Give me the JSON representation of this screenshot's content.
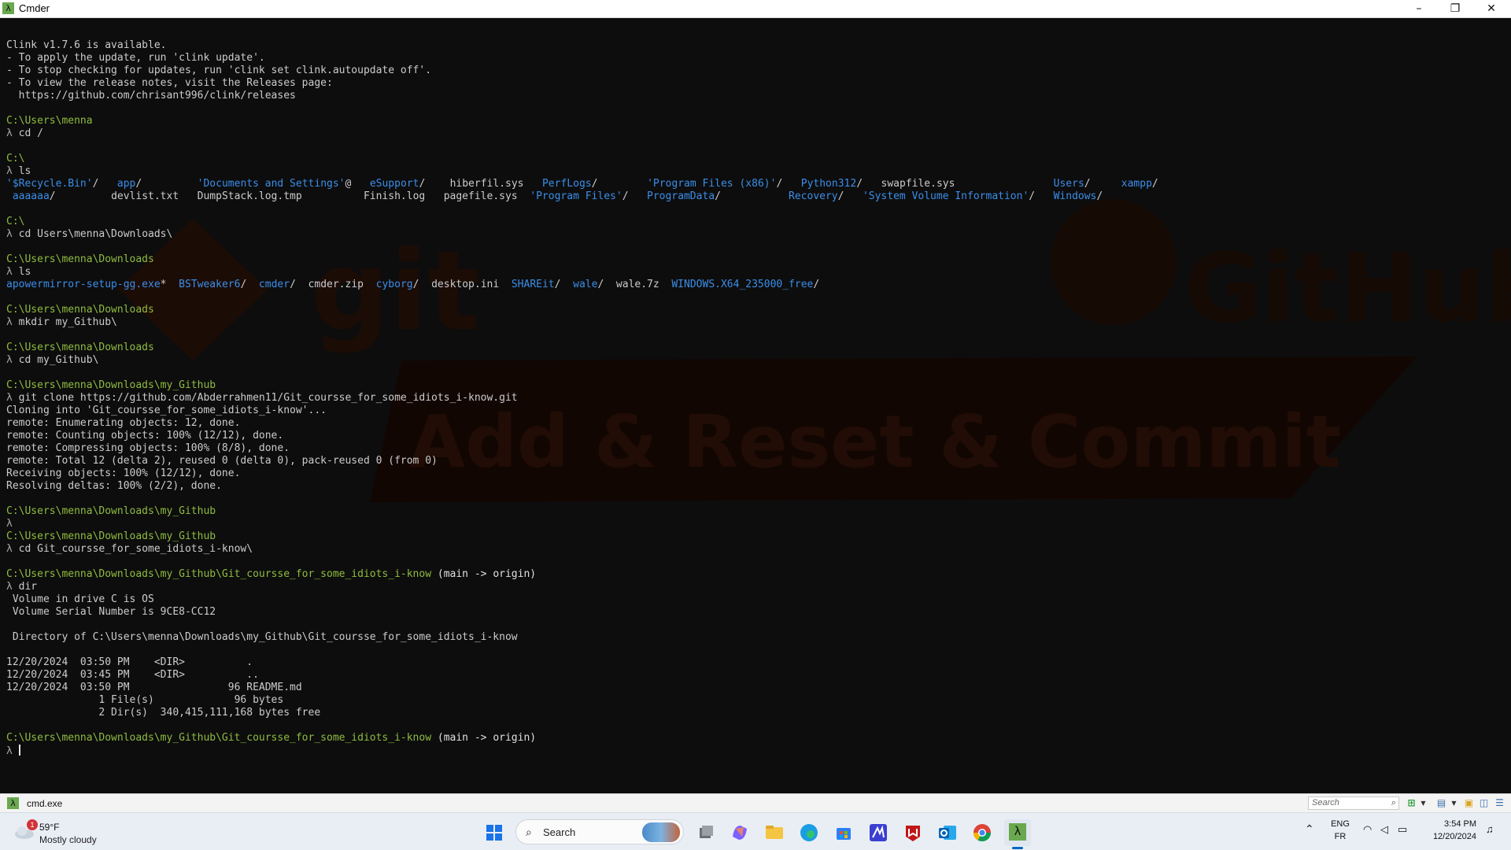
{
  "window": {
    "title": "Cmder",
    "app_icon": "lambda-icon",
    "controls": {
      "minimize": "–",
      "maximize": "❐",
      "close": "✕"
    }
  },
  "terminal": {
    "watermark_text": {
      "git": "git",
      "github": "GitHub",
      "subtitle": "Add & Reset & Commit"
    },
    "lines": [
      [
        {
          "t": "Clink v1.7.6 is available.",
          "c": ""
        }
      ],
      [
        {
          "t": "- To apply the update, run 'clink update'.",
          "c": ""
        }
      ],
      [
        {
          "t": "- To stop checking for updates, run 'clink set clink.autoupdate off'.",
          "c": ""
        }
      ],
      [
        {
          "t": "- To view the release notes, visit the Releases page:",
          "c": ""
        }
      ],
      [
        {
          "t": "  https://github.com/chrisant996/clink/releases",
          "c": ""
        }
      ],
      [],
      [
        {
          "t": "C:\\Users\\menna",
          "c": "prompt"
        }
      ],
      [
        {
          "t": "λ ",
          "c": "lam"
        },
        {
          "t": "cd /",
          "c": ""
        }
      ],
      [],
      [
        {
          "t": "C:\\",
          "c": "prompt"
        }
      ],
      [
        {
          "t": "λ ",
          "c": "lam"
        },
        {
          "t": "ls",
          "c": ""
        }
      ],
      [
        {
          "t": "'$Recycle.Bin'",
          "c": "dir"
        },
        {
          "t": "/   ",
          "c": ""
        },
        {
          "t": "app",
          "c": "dir"
        },
        {
          "t": "/         ",
          "c": ""
        },
        {
          "t": "'Documents and Settings'",
          "c": "dir"
        },
        {
          "t": "@   ",
          "c": ""
        },
        {
          "t": "eSupport",
          "c": "dir"
        },
        {
          "t": "/    hiberfil.sys   ",
          "c": ""
        },
        {
          "t": "PerfLogs",
          "c": "dir"
        },
        {
          "t": "/        ",
          "c": ""
        },
        {
          "t": "'Program Files (x86)'",
          "c": "dir"
        },
        {
          "t": "/   ",
          "c": ""
        },
        {
          "t": "Python312",
          "c": "dir"
        },
        {
          "t": "/   swapfile.sys                ",
          "c": ""
        },
        {
          "t": "Users",
          "c": "dir"
        },
        {
          "t": "/     ",
          "c": ""
        },
        {
          "t": "xampp",
          "c": "dir"
        },
        {
          "t": "/",
          "c": ""
        }
      ],
      [
        {
          "t": " ",
          "c": ""
        },
        {
          "t": "aaaaaa",
          "c": "dir"
        },
        {
          "t": "/         devlist.txt   DumpStack.log.tmp          Finish.log   pagefile.sys  ",
          "c": ""
        },
        {
          "t": "'Program Files'",
          "c": "dir"
        },
        {
          "t": "/   ",
          "c": ""
        },
        {
          "t": "ProgramData",
          "c": "dir"
        },
        {
          "t": "/           ",
          "c": ""
        },
        {
          "t": "Recovery",
          "c": "dir"
        },
        {
          "t": "/   ",
          "c": ""
        },
        {
          "t": "'System Volume Information'",
          "c": "dir"
        },
        {
          "t": "/   ",
          "c": ""
        },
        {
          "t": "Windows",
          "c": "dir"
        },
        {
          "t": "/",
          "c": ""
        }
      ],
      [],
      [
        {
          "t": "C:\\",
          "c": "prompt"
        }
      ],
      [
        {
          "t": "λ ",
          "c": "lam"
        },
        {
          "t": "cd Users\\menna\\Downloads\\",
          "c": ""
        }
      ],
      [],
      [
        {
          "t": "C:\\Users\\menna\\Downloads",
          "c": "prompt"
        }
      ],
      [
        {
          "t": "λ ",
          "c": "lam"
        },
        {
          "t": "ls",
          "c": ""
        }
      ],
      [
        {
          "t": "apowermirror-setup-gg.exe",
          "c": "dir"
        },
        {
          "t": "*  ",
          "c": ""
        },
        {
          "t": "BSTweaker6",
          "c": "dir"
        },
        {
          "t": "/  ",
          "c": ""
        },
        {
          "t": "cmder",
          "c": "dir"
        },
        {
          "t": "/  cmder.zip  ",
          "c": ""
        },
        {
          "t": "cyborg",
          "c": "dir"
        },
        {
          "t": "/  desktop.ini  ",
          "c": ""
        },
        {
          "t": "SHAREit",
          "c": "dir"
        },
        {
          "t": "/  ",
          "c": ""
        },
        {
          "t": "wale",
          "c": "dir"
        },
        {
          "t": "/  wale.7z  ",
          "c": ""
        },
        {
          "t": "WINDOWS.X64_235000_free",
          "c": "dir"
        },
        {
          "t": "/",
          "c": ""
        }
      ],
      [],
      [
        {
          "t": "C:\\Users\\menna\\Downloads",
          "c": "prompt"
        }
      ],
      [
        {
          "t": "λ ",
          "c": "lam"
        },
        {
          "t": "mkdir my_Github\\",
          "c": ""
        }
      ],
      [],
      [
        {
          "t": "C:\\Users\\menna\\Downloads",
          "c": "prompt"
        }
      ],
      [
        {
          "t": "λ ",
          "c": "lam"
        },
        {
          "t": "cd my_Github\\",
          "c": ""
        }
      ],
      [],
      [
        {
          "t": "C:\\Users\\menna\\Downloads\\my_Github",
          "c": "prompt"
        }
      ],
      [
        {
          "t": "λ ",
          "c": "lam"
        },
        {
          "t": "git clone https://github.com/Abderrahmen11/Git_coursse_for_some_idiots_i-know.git",
          "c": ""
        }
      ],
      [
        {
          "t": "Cloning into 'Git_coursse_for_some_idiots_i-know'...",
          "c": ""
        }
      ],
      [
        {
          "t": "remote: Enumerating objects: 12, done.",
          "c": ""
        }
      ],
      [
        {
          "t": "remote: Counting objects: 100% (12/12), done.",
          "c": ""
        }
      ],
      [
        {
          "t": "remote: Compressing objects: 100% (8/8), done.",
          "c": ""
        }
      ],
      [
        {
          "t": "remote: Total 12 (delta 2), reused 0 (delta 0), pack-reused 0 (from 0)",
          "c": ""
        }
      ],
      [
        {
          "t": "Receiving objects: 100% (12/12), done.",
          "c": ""
        }
      ],
      [
        {
          "t": "Resolving deltas: 100% (2/2), done.",
          "c": ""
        }
      ],
      [],
      [
        {
          "t": "C:\\Users\\menna\\Downloads\\my_Github",
          "c": "prompt"
        }
      ],
      [
        {
          "t": "λ",
          "c": "lam"
        }
      ],
      [
        {
          "t": "C:\\Users\\menna\\Downloads\\my_Github",
          "c": "prompt"
        }
      ],
      [
        {
          "t": "λ ",
          "c": "lam"
        },
        {
          "t": "cd Git_coursse_for_some_idiots_i-know\\",
          "c": ""
        }
      ],
      [],
      [
        {
          "t": "C:\\Users\\menna\\Downloads\\my_Github\\Git_coursse_for_some_idiots_i-know",
          "c": "prompt"
        },
        {
          "t": " (main -> origin)",
          "c": "branch"
        }
      ],
      [
        {
          "t": "λ ",
          "c": "lam"
        },
        {
          "t": "dir",
          "c": ""
        }
      ],
      [
        {
          "t": " Volume in drive C is OS",
          "c": ""
        }
      ],
      [
        {
          "t": " Volume Serial Number is 9CE8-CC12",
          "c": ""
        }
      ],
      [],
      [
        {
          "t": " Directory of C:\\Users\\menna\\Downloads\\my_Github\\Git_coursse_for_some_idiots_i-know",
          "c": ""
        }
      ],
      [],
      [
        {
          "t": "12/20/2024  03:50 PM    <DIR>          .",
          "c": ""
        }
      ],
      [
        {
          "t": "12/20/2024  03:45 PM    <DIR>          ..",
          "c": ""
        }
      ],
      [
        {
          "t": "12/20/2024  03:50 PM                96 README.md",
          "c": ""
        }
      ],
      [
        {
          "t": "               1 File(s)             96 bytes",
          "c": ""
        }
      ],
      [
        {
          "t": "               2 Dir(s)  340,415,111,168 bytes free",
          "c": ""
        }
      ],
      [],
      [
        {
          "t": "C:\\Users\\menna\\Downloads\\my_Github\\Git_coursse_for_some_idiots_i-know",
          "c": "prompt"
        },
        {
          "t": " (main -> origin)",
          "c": "branch"
        }
      ],
      [
        {
          "t": "λ ",
          "c": "lam"
        },
        {
          "t": "",
          "c": "caret"
        }
      ]
    ]
  },
  "statusbar": {
    "tab_label": "cmd.exe",
    "tab_icon": "lambda-icon",
    "search_placeholder": "Search",
    "icons": [
      "search-icon",
      "new-console-icon",
      "dropdown-icon",
      "layout-icon",
      "dropdown-icon",
      "lock-icon",
      "split-icon",
      "menu-icon"
    ]
  },
  "taskbar": {
    "weather": {
      "temp": "59°F",
      "condition": "Mostly cloudy",
      "badge": "1"
    },
    "search_label": "Search",
    "apps": [
      "start-icon",
      "task-view-icon",
      "copilot-icon",
      "file-explorer-icon",
      "edge-icon",
      "store-icon",
      "dev-app-icon",
      "mcafee-icon",
      "outlook-icon",
      "chrome-icon",
      "cmder-icon"
    ],
    "tray": {
      "lang_top": "ENG",
      "lang_bottom": "FR",
      "time": "3:54 PM",
      "date": "12/20/2024"
    }
  },
  "colors": {
    "prompt": "#8fbc3f",
    "directory": "#3b8eea",
    "terminal_bg": "#0d0d0d",
    "text": "#cccccc",
    "accent": "#0067c0"
  }
}
